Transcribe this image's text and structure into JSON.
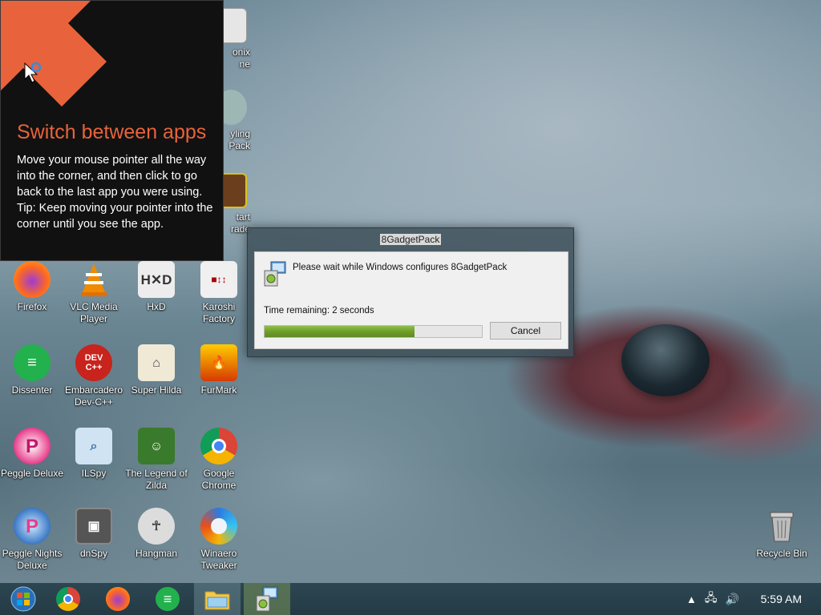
{
  "tip": {
    "title": "Switch between apps",
    "body": "Move your mouse pointer all the way into the corner, and then click to go back to the last app you were using.",
    "tip_line": "Tip: Keep moving your pointer into the corner until you see the app.",
    "accent": "#e8633b"
  },
  "partial_icons": [
    {
      "label": "onix\nne"
    },
    {
      "label": "yling\nPack"
    },
    {
      "label": "tart\nrade"
    }
  ],
  "desktop_icons": [
    {
      "label": "Firefox",
      "icon": "firefox-icon"
    },
    {
      "label": "VLC Media Player",
      "icon": "vlc-icon"
    },
    {
      "label": "HxD",
      "icon": "hxd-icon"
    },
    {
      "label": "Karoshi Factory",
      "icon": "karoshi-icon"
    },
    {
      "label": "Dissenter",
      "icon": "dissenter-icon"
    },
    {
      "label": "Embarcadero Dev-C++",
      "icon": "devcpp-icon"
    },
    {
      "label": "Super Hilda",
      "icon": "super-hilda-icon"
    },
    {
      "label": "FurMark",
      "icon": "furmark-icon"
    },
    {
      "label": "Peggle Deluxe",
      "icon": "peggle-icon"
    },
    {
      "label": "ILSpy",
      "icon": "ilspy-icon"
    },
    {
      "label": "The Legend of Zilda",
      "icon": "zilda-icon"
    },
    {
      "label": "Google Chrome",
      "icon": "chrome-icon"
    },
    {
      "label": "Peggle Nights Deluxe",
      "icon": "peggle-nights-icon"
    },
    {
      "label": "dnSpy",
      "icon": "dnspy-icon"
    },
    {
      "label": "Hangman",
      "icon": "hangman-icon"
    },
    {
      "label": "Winaero Tweaker",
      "icon": "winaero-icon"
    },
    {
      "label": "Recycle Bin",
      "icon": "recycle-bin-icon"
    }
  ],
  "dialog": {
    "title": "8GadgetPack",
    "message": "Please wait while Windows configures 8GadgetPack",
    "time_remaining": "Time remaining: 2 seconds",
    "progress": 0.69,
    "cancel_label": "Cancel"
  },
  "taskbar": {
    "items": [
      {
        "icon": "start-orb-icon"
      },
      {
        "icon": "chrome-icon"
      },
      {
        "icon": "firefox-icon"
      },
      {
        "icon": "dissenter-icon"
      },
      {
        "icon": "file-explorer-icon"
      },
      {
        "icon": "installer-icon"
      }
    ],
    "clock": "5:59 AM"
  }
}
